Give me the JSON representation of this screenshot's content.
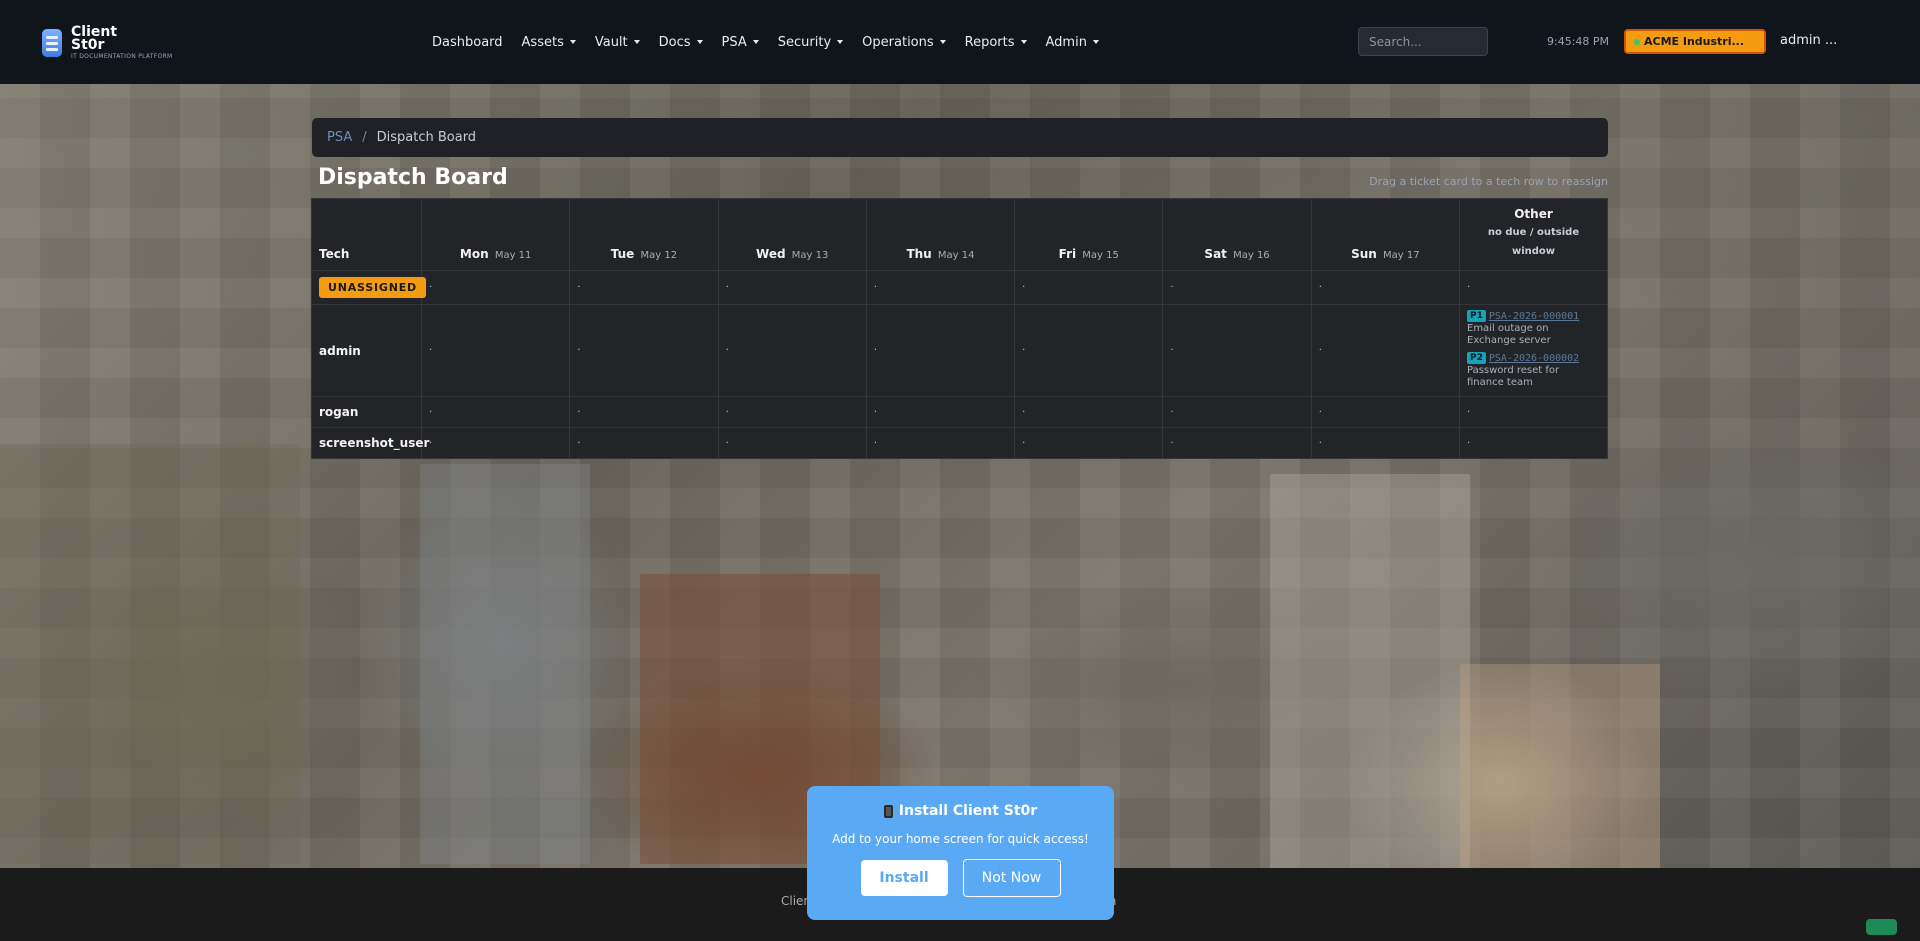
{
  "brand": {
    "name": "Client St0r",
    "tagline": "IT DOCUMENTATION PLATFORM"
  },
  "nav": {
    "items": [
      {
        "label": "Dashboard",
        "dropdown": false
      },
      {
        "label": "Assets",
        "dropdown": true
      },
      {
        "label": "Vault",
        "dropdown": true
      },
      {
        "label": "Docs",
        "dropdown": true
      },
      {
        "label": "PSA",
        "dropdown": true
      },
      {
        "label": "Security",
        "dropdown": true
      },
      {
        "label": "Operations",
        "dropdown": true
      },
      {
        "label": "Reports",
        "dropdown": true
      },
      {
        "label": "Admin",
        "dropdown": true
      }
    ],
    "search_placeholder": "Search...",
    "clock": "9:45:48 PM",
    "tenant": "ACME Industri...",
    "user": "admin ..."
  },
  "breadcrumb": {
    "parent": "PSA",
    "current": "Dispatch Board"
  },
  "page": {
    "title": "Dispatch Board",
    "hint": "Drag a ticket card to a tech row to reassign"
  },
  "board": {
    "tech_header": "Tech",
    "days": [
      {
        "day": "Mon",
        "date": "May 11"
      },
      {
        "day": "Tue",
        "date": "May 12"
      },
      {
        "day": "Wed",
        "date": "May 13"
      },
      {
        "day": "Thu",
        "date": "May 14"
      },
      {
        "day": "Fri",
        "date": "May 15"
      },
      {
        "day": "Sat",
        "date": "May 16"
      },
      {
        "day": "Sun",
        "date": "May 17"
      }
    ],
    "other": {
      "title": "Other",
      "subtitle_line1": "no due / outside",
      "subtitle_line2": "window"
    },
    "empty_marker": "·",
    "rows": {
      "unassigned": {
        "label": "UNASSIGNED"
      },
      "admin": {
        "label": "admin",
        "tickets": [
          {
            "priority": "P1",
            "id": "PSA-2026-000001",
            "desc_line1": "Email outage on",
            "desc_line2": "Exchange server"
          },
          {
            "priority": "P2",
            "id": "PSA-2026-000002",
            "desc_line1": "Password reset for",
            "desc_line2": "finance team"
          }
        ]
      },
      "rogan": {
        "label": "rogan"
      },
      "screenshot_user": {
        "label": "screenshot_user"
      }
    }
  },
  "footer": {
    "left_fragment": "Clien",
    "right_fragment": "ation"
  },
  "install_prompt": {
    "title": "Install Client St0r",
    "text": "Add to your home screen for quick access!",
    "install_label": "Install",
    "dismiss_label": "Not Now"
  }
}
